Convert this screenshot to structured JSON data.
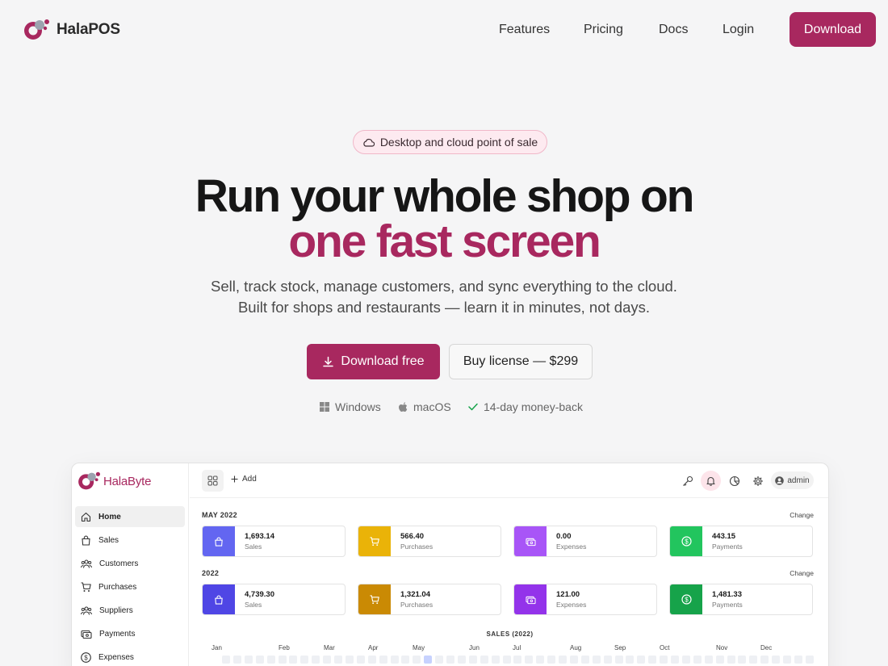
{
  "nav": {
    "brand": "HalaPOS",
    "links": [
      "Features",
      "Pricing",
      "Docs",
      "Login"
    ],
    "download": "Download"
  },
  "hero": {
    "pill": "Desktop and cloud point of sale",
    "title_line1": "Run your whole shop on",
    "title_line2": "one fast screen",
    "sub_line1": "Sell, track stock, manage customers, and sync everything to the cloud.",
    "sub_line2": "Built for shops and restaurants — learn it in minutes, not days.",
    "cta_primary": "Download free",
    "cta_secondary": "Buy license — $299",
    "platforms": [
      "Windows",
      "macOS",
      "14-day money-back"
    ]
  },
  "app": {
    "logo_text": "HalaByte",
    "sidebar": [
      "Home",
      "Sales",
      "Customers",
      "Purchases",
      "Suppliers",
      "Payments",
      "Expenses"
    ],
    "active_item": "Home",
    "topbar": {
      "add": "Add",
      "user": "admin"
    },
    "sections": [
      {
        "label": "MAY 2022",
        "change": "Change",
        "cards": [
          {
            "value": "1,693.14",
            "label": "Sales",
            "color": "#6366f1"
          },
          {
            "value": "566.40",
            "label": "Purchases",
            "color": "#eab308"
          },
          {
            "value": "0.00",
            "label": "Expenses",
            "color": "#a855f7"
          },
          {
            "value": "443.15",
            "label": "Payments",
            "color": "#22c55e"
          }
        ]
      },
      {
        "label": "2022",
        "change": "Change",
        "cards": [
          {
            "value": "4,739.30",
            "label": "Sales",
            "color": "#4f46e5"
          },
          {
            "value": "1,321.04",
            "label": "Purchases",
            "color": "#ca8a04"
          },
          {
            "value": "121.00",
            "label": "Expenses",
            "color": "#9333ea"
          },
          {
            "value": "1,481.33",
            "label": "Payments",
            "color": "#16a34a"
          }
        ]
      }
    ],
    "sales_title": "SALES (2022)",
    "months": [
      "Jan",
      "Feb",
      "Mar",
      "Apr",
      "May",
      "Jun",
      "Jul",
      "Aug",
      "Sep",
      "Oct",
      "Nov",
      "Dec"
    ]
  },
  "colors": {
    "brand": "#a8285f",
    "pill_bg": "#fdeaf0",
    "pill_border": "#f0b7c8"
  }
}
